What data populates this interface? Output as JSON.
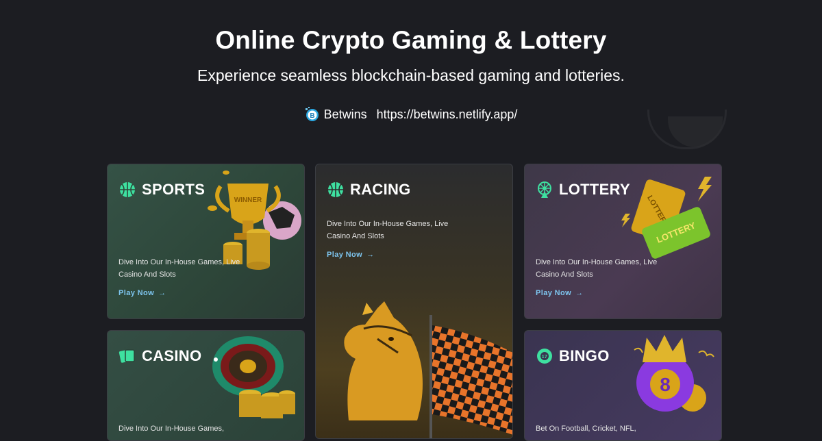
{
  "header": {
    "title": "Online Crypto Gaming & Lottery",
    "subtitle": "Experience seamless blockchain-based gaming and lotteries.",
    "brand_name": "Betwins",
    "brand_url": "https://betwins.netlify.app/"
  },
  "cards": {
    "sports": {
      "title": "SPORTS",
      "desc": "Dive Into Our In-House Games, Live Casino And Slots",
      "link": "Play Now",
      "arrow": "→"
    },
    "racing": {
      "title": "RACING",
      "desc": "Dive Into Our In-House Games, Live Casino And Slots",
      "link": "Play Now",
      "arrow": "→"
    },
    "lottery": {
      "title": "LOTTERY",
      "desc": "Dive Into Our In-House Games, Live Casino And Slots",
      "link": "Play Now",
      "arrow": "→"
    },
    "casino": {
      "title": "CASINO",
      "desc": "Dive Into Our In-House Games,"
    },
    "bingo": {
      "title": "BINGO",
      "desc": "Bet On Football, Cricket, NFL,"
    }
  },
  "art": {
    "trophy_text": "WINNER",
    "ticket_text_1": "LOTTERY",
    "ticket_text_2": "LOTTERY",
    "bingo_ball_number": "8"
  },
  "icons": {
    "brand": "betwins-logo-icon",
    "sports": "basketball-icon",
    "racing": "basketball-icon",
    "lottery": "ferris-wheel-icon",
    "casino": "playing-cards-icon",
    "bingo": "lottery-ball-icon"
  },
  "colors": {
    "background": "#1c1d22",
    "accent_icon": "#3ee0a0",
    "link": "#7ec6f0"
  }
}
